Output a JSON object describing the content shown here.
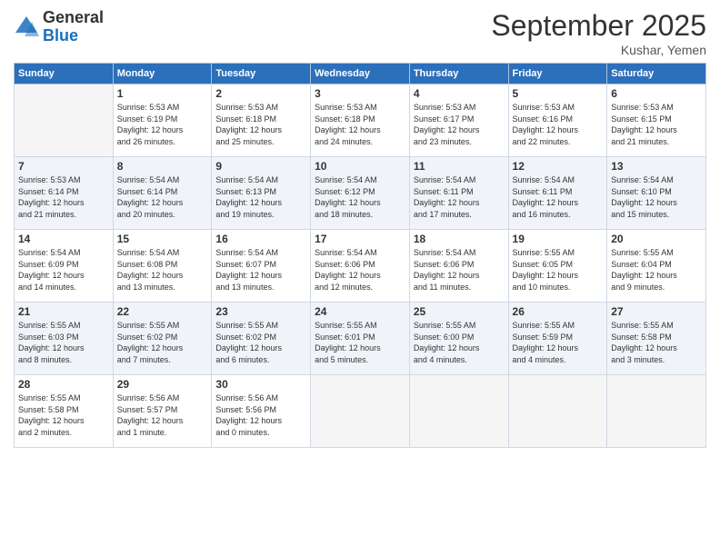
{
  "logo": {
    "general": "General",
    "blue": "Blue"
  },
  "header": {
    "month": "September 2025",
    "location": "Kushar, Yemen"
  },
  "weekdays": [
    "Sunday",
    "Monday",
    "Tuesday",
    "Wednesday",
    "Thursday",
    "Friday",
    "Saturday"
  ],
  "weeks": [
    [
      {
        "day": "",
        "info": ""
      },
      {
        "day": "1",
        "info": "Sunrise: 5:53 AM\nSunset: 6:19 PM\nDaylight: 12 hours\nand 26 minutes."
      },
      {
        "day": "2",
        "info": "Sunrise: 5:53 AM\nSunset: 6:18 PM\nDaylight: 12 hours\nand 25 minutes."
      },
      {
        "day": "3",
        "info": "Sunrise: 5:53 AM\nSunset: 6:18 PM\nDaylight: 12 hours\nand 24 minutes."
      },
      {
        "day": "4",
        "info": "Sunrise: 5:53 AM\nSunset: 6:17 PM\nDaylight: 12 hours\nand 23 minutes."
      },
      {
        "day": "5",
        "info": "Sunrise: 5:53 AM\nSunset: 6:16 PM\nDaylight: 12 hours\nand 22 minutes."
      },
      {
        "day": "6",
        "info": "Sunrise: 5:53 AM\nSunset: 6:15 PM\nDaylight: 12 hours\nand 21 minutes."
      }
    ],
    [
      {
        "day": "7",
        "info": "Sunrise: 5:53 AM\nSunset: 6:14 PM\nDaylight: 12 hours\nand 21 minutes."
      },
      {
        "day": "8",
        "info": "Sunrise: 5:54 AM\nSunset: 6:14 PM\nDaylight: 12 hours\nand 20 minutes."
      },
      {
        "day": "9",
        "info": "Sunrise: 5:54 AM\nSunset: 6:13 PM\nDaylight: 12 hours\nand 19 minutes."
      },
      {
        "day": "10",
        "info": "Sunrise: 5:54 AM\nSunset: 6:12 PM\nDaylight: 12 hours\nand 18 minutes."
      },
      {
        "day": "11",
        "info": "Sunrise: 5:54 AM\nSunset: 6:11 PM\nDaylight: 12 hours\nand 17 minutes."
      },
      {
        "day": "12",
        "info": "Sunrise: 5:54 AM\nSunset: 6:11 PM\nDaylight: 12 hours\nand 16 minutes."
      },
      {
        "day": "13",
        "info": "Sunrise: 5:54 AM\nSunset: 6:10 PM\nDaylight: 12 hours\nand 15 minutes."
      }
    ],
    [
      {
        "day": "14",
        "info": "Sunrise: 5:54 AM\nSunset: 6:09 PM\nDaylight: 12 hours\nand 14 minutes."
      },
      {
        "day": "15",
        "info": "Sunrise: 5:54 AM\nSunset: 6:08 PM\nDaylight: 12 hours\nand 13 minutes."
      },
      {
        "day": "16",
        "info": "Sunrise: 5:54 AM\nSunset: 6:07 PM\nDaylight: 12 hours\nand 13 minutes."
      },
      {
        "day": "17",
        "info": "Sunrise: 5:54 AM\nSunset: 6:06 PM\nDaylight: 12 hours\nand 12 minutes."
      },
      {
        "day": "18",
        "info": "Sunrise: 5:54 AM\nSunset: 6:06 PM\nDaylight: 12 hours\nand 11 minutes."
      },
      {
        "day": "19",
        "info": "Sunrise: 5:55 AM\nSunset: 6:05 PM\nDaylight: 12 hours\nand 10 minutes."
      },
      {
        "day": "20",
        "info": "Sunrise: 5:55 AM\nSunset: 6:04 PM\nDaylight: 12 hours\nand 9 minutes."
      }
    ],
    [
      {
        "day": "21",
        "info": "Sunrise: 5:55 AM\nSunset: 6:03 PM\nDaylight: 12 hours\nand 8 minutes."
      },
      {
        "day": "22",
        "info": "Sunrise: 5:55 AM\nSunset: 6:02 PM\nDaylight: 12 hours\nand 7 minutes."
      },
      {
        "day": "23",
        "info": "Sunrise: 5:55 AM\nSunset: 6:02 PM\nDaylight: 12 hours\nand 6 minutes."
      },
      {
        "day": "24",
        "info": "Sunrise: 5:55 AM\nSunset: 6:01 PM\nDaylight: 12 hours\nand 5 minutes."
      },
      {
        "day": "25",
        "info": "Sunrise: 5:55 AM\nSunset: 6:00 PM\nDaylight: 12 hours\nand 4 minutes."
      },
      {
        "day": "26",
        "info": "Sunrise: 5:55 AM\nSunset: 5:59 PM\nDaylight: 12 hours\nand 4 minutes."
      },
      {
        "day": "27",
        "info": "Sunrise: 5:55 AM\nSunset: 5:58 PM\nDaylight: 12 hours\nand 3 minutes."
      }
    ],
    [
      {
        "day": "28",
        "info": "Sunrise: 5:55 AM\nSunset: 5:58 PM\nDaylight: 12 hours\nand 2 minutes."
      },
      {
        "day": "29",
        "info": "Sunrise: 5:56 AM\nSunset: 5:57 PM\nDaylight: 12 hours\nand 1 minute."
      },
      {
        "day": "30",
        "info": "Sunrise: 5:56 AM\nSunset: 5:56 PM\nDaylight: 12 hours\nand 0 minutes."
      },
      {
        "day": "",
        "info": ""
      },
      {
        "day": "",
        "info": ""
      },
      {
        "day": "",
        "info": ""
      },
      {
        "day": "",
        "info": ""
      }
    ]
  ]
}
